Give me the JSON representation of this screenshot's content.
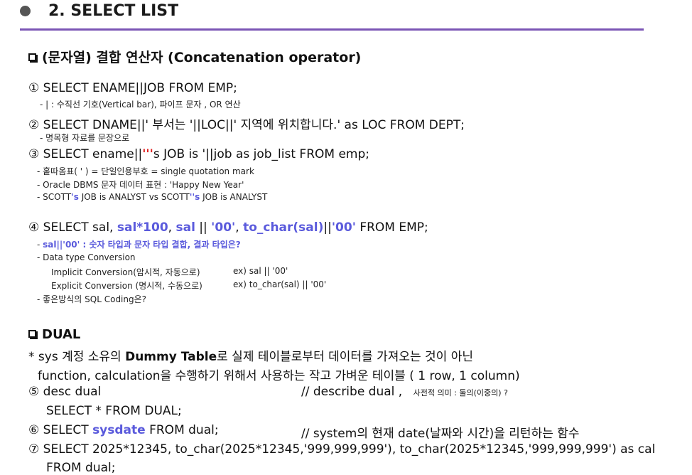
{
  "header": {
    "title": "2. SELECT   LIST"
  },
  "section1": {
    "heading": "(문자열) 결합 연산자 (Concatenation operator)",
    "item1": {
      "num": "①",
      "text": "SELECT   ENAME||JOB   FROM EMP;",
      "note": "- |  : 수직선 기호(Vertical bar),  파이프 문자 , OR 연산"
    },
    "item2": {
      "num": "②",
      "text": "SELECT DNAME||' 부서는 '||LOC||' 지역에 위치합니다.' as LOC FROM DEPT;",
      "note": "- 명목형 자료를 문장으로"
    },
    "item3": {
      "num": "③",
      "text_a": "SELECT   ename||",
      "text_q": "'''",
      "text_b": "s JOB is '||job as job_list FROM emp;",
      "note1": "- 홑따옴표( ' ) = 단일인용부호 = single quotation mark",
      "note2": "- Oracle DBMS 문자 데이터 표현 :  'Happy New Year'",
      "note3_a": "- SCOTT",
      "note3_b": "'s",
      "note3_c": " JOB is ANALYST  vs  SCOTT",
      "note3_d": "''s",
      "note3_e": " JOB is ANALYST"
    },
    "item4": {
      "num": "④",
      "t1": "SELECT   sal,  ",
      "t2": "sal*100",
      "t3": ",  ",
      "t4": "sal",
      "t5": " || ",
      "t6": "'00'",
      "t7": ",  ",
      "t8": "to_char(sal)",
      "t9": "||",
      "t10": "'00'",
      "t11": " FROM EMP;",
      "note1_a": "- ",
      "note1_b": "sal||'00'  : 숫자 타입과 문자 타입 결합, 결과 타입은?",
      "note2": "- Data type Conversion",
      "note3_label": "Implicit Conversion(암시적, 자동으로)",
      "note3_ex": "ex) sal || '00'",
      "note4_label": "Explicit Conversion (명시적, 수동으로)",
      "note4_ex": "ex) to_char(sal) || '00'",
      "note5": "- 좋은방식의 SQL Coding은?"
    }
  },
  "section2": {
    "heading": "DUAL",
    "desc1_a": "* sys 계정 소유의 ",
    "desc1_b": "Dummy Table",
    "desc1_c": "로 실제 테이블로부터 데이터를 가져오는 것이 아닌",
    "desc2": "function, calculation을 수행하기 위해서 사용하는 작고 가벼운 테이블  ( 1 row, 1 column)",
    "item5": {
      "num": "⑤",
      "text": "desc  dual",
      "comment": "// describe  dual ,",
      "comment_small": "사전적 의미 : 둘의(이중의) ?",
      "line2": "SELECT * FROM DUAL;"
    },
    "item6": {
      "num": "⑥",
      "t1": "SELECT   ",
      "t2": "sysdate",
      "t3": "  FROM dual;",
      "comment": "//  system의  현재 date(날짜와 시간)을 리턴하는 함수"
    },
    "item7": {
      "num": "⑦",
      "text": "SELECT   2025*12345, to_char(2025*12345,'999,999,999'), to_char(2025*12345,'999,999,999') as cal",
      "line2": "FROM   dual;"
    }
  }
}
